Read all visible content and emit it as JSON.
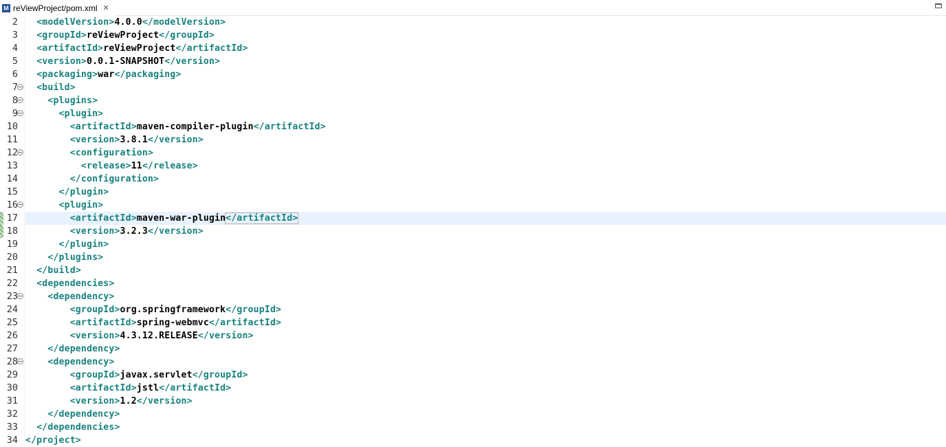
{
  "tab": {
    "icon_letter": "M",
    "title": "reViewProject/pom.xml",
    "close": "✕"
  },
  "colors": {
    "tag": "#17827f",
    "text": "#000000",
    "current_line": "#e8f2fe"
  },
  "editor": {
    "current_line": 17,
    "lines": [
      {
        "n": "2",
        "fold": false,
        "indent": "  ",
        "parts": [
          [
            "t",
            "<modelVersion>"
          ],
          [
            "x",
            "4.0.0"
          ],
          [
            "t",
            "</modelVersion>"
          ]
        ]
      },
      {
        "n": "3",
        "fold": false,
        "indent": "  ",
        "parts": [
          [
            "t",
            "<groupId>"
          ],
          [
            "x",
            "reViewProject"
          ],
          [
            "t",
            "</groupId>"
          ]
        ]
      },
      {
        "n": "4",
        "fold": false,
        "indent": "  ",
        "parts": [
          [
            "t",
            "<artifactId>"
          ],
          [
            "x",
            "reViewProject"
          ],
          [
            "t",
            "</artifactId>"
          ]
        ]
      },
      {
        "n": "5",
        "fold": false,
        "indent": "  ",
        "parts": [
          [
            "t",
            "<version>"
          ],
          [
            "x",
            "0.0.1-SNAPSHOT"
          ],
          [
            "t",
            "</version>"
          ]
        ]
      },
      {
        "n": "6",
        "fold": false,
        "indent": "  ",
        "parts": [
          [
            "t",
            "<packaging>"
          ],
          [
            "x",
            "war"
          ],
          [
            "t",
            "</packaging>"
          ]
        ]
      },
      {
        "n": "7",
        "fold": true,
        "indent": "  ",
        "parts": [
          [
            "t",
            "<build>"
          ]
        ]
      },
      {
        "n": "8",
        "fold": true,
        "indent": "    ",
        "parts": [
          [
            "t",
            "<plugins>"
          ]
        ]
      },
      {
        "n": "9",
        "fold": true,
        "indent": "      ",
        "parts": [
          [
            "t",
            "<plugin>"
          ]
        ]
      },
      {
        "n": "10",
        "fold": false,
        "indent": "        ",
        "parts": [
          [
            "t",
            "<artifactId>"
          ],
          [
            "x",
            "maven-compiler-plugin"
          ],
          [
            "t",
            "</artifactId>"
          ]
        ]
      },
      {
        "n": "11",
        "fold": false,
        "indent": "        ",
        "parts": [
          [
            "t",
            "<version>"
          ],
          [
            "x",
            "3.8.1"
          ],
          [
            "t",
            "</version>"
          ]
        ]
      },
      {
        "n": "12",
        "fold": true,
        "indent": "        ",
        "parts": [
          [
            "t",
            "<configuration>"
          ]
        ]
      },
      {
        "n": "13",
        "fold": false,
        "indent": "          ",
        "parts": [
          [
            "t",
            "<release>"
          ],
          [
            "x",
            "11"
          ],
          [
            "t",
            "</release>"
          ]
        ]
      },
      {
        "n": "14",
        "fold": false,
        "indent": "        ",
        "parts": [
          [
            "t",
            "</configuration>"
          ]
        ]
      },
      {
        "n": "15",
        "fold": false,
        "indent": "      ",
        "parts": [
          [
            "t",
            "</plugin>"
          ]
        ]
      },
      {
        "n": "16",
        "fold": true,
        "indent": "      ",
        "parts": [
          [
            "t",
            "<plugin>"
          ]
        ]
      },
      {
        "n": "17",
        "fold": false,
        "indent": "        ",
        "parts": [
          [
            "t",
            "<artifactId>"
          ],
          [
            "x",
            "maven-war-plugin"
          ],
          [
            "t",
            "</artifactId>"
          ]
        ]
      },
      {
        "n": "18",
        "fold": false,
        "indent": "        ",
        "parts": [
          [
            "t",
            "<version>"
          ],
          [
            "x",
            "3.2.3"
          ],
          [
            "t",
            "</version>"
          ]
        ]
      },
      {
        "n": "19",
        "fold": false,
        "indent": "      ",
        "parts": [
          [
            "t",
            "</plugin>"
          ]
        ]
      },
      {
        "n": "20",
        "fold": false,
        "indent": "    ",
        "parts": [
          [
            "t",
            "</plugins>"
          ]
        ]
      },
      {
        "n": "21",
        "fold": false,
        "indent": "  ",
        "parts": [
          [
            "t",
            "</build>"
          ]
        ]
      },
      {
        "n": "22",
        "fold": false,
        "indent": "  ",
        "parts": [
          [
            "t",
            "<dependencies>"
          ]
        ]
      },
      {
        "n": "23",
        "fold": true,
        "indent": "    ",
        "parts": [
          [
            "t",
            "<dependency>"
          ]
        ]
      },
      {
        "n": "24",
        "fold": false,
        "indent": "        ",
        "parts": [
          [
            "t",
            "<groupId>"
          ],
          [
            "x",
            "org.springframework"
          ],
          [
            "t",
            "</groupId>"
          ]
        ]
      },
      {
        "n": "25",
        "fold": false,
        "indent": "        ",
        "parts": [
          [
            "t",
            "<artifactId>"
          ],
          [
            "x",
            "spring-webmvc"
          ],
          [
            "t",
            "</artifactId>"
          ]
        ]
      },
      {
        "n": "26",
        "fold": false,
        "indent": "        ",
        "parts": [
          [
            "t",
            "<version>"
          ],
          [
            "x",
            "4.3.12.RELEASE"
          ],
          [
            "t",
            "</version>"
          ]
        ]
      },
      {
        "n": "27",
        "fold": false,
        "indent": "    ",
        "parts": [
          [
            "t",
            "</dependency>"
          ]
        ]
      },
      {
        "n": "28",
        "fold": true,
        "indent": "    ",
        "parts": [
          [
            "t",
            "<dependency>"
          ]
        ]
      },
      {
        "n": "29",
        "fold": false,
        "indent": "        ",
        "parts": [
          [
            "t",
            "<groupId>"
          ],
          [
            "x",
            "javax.servlet"
          ],
          [
            "t",
            "</groupId>"
          ]
        ]
      },
      {
        "n": "30",
        "fold": false,
        "indent": "        ",
        "parts": [
          [
            "t",
            "<artifactId>"
          ],
          [
            "x",
            "jstl"
          ],
          [
            "t",
            "</artifactId>"
          ]
        ]
      },
      {
        "n": "31",
        "fold": false,
        "indent": "        ",
        "parts": [
          [
            "t",
            "<version>"
          ],
          [
            "x",
            "1.2"
          ],
          [
            "t",
            "</version>"
          ]
        ]
      },
      {
        "n": "32",
        "fold": false,
        "indent": "    ",
        "parts": [
          [
            "t",
            "</dependency>"
          ]
        ]
      },
      {
        "n": "33",
        "fold": false,
        "indent": "  ",
        "parts": [
          [
            "t",
            "</dependencies>"
          ]
        ]
      },
      {
        "n": "34",
        "fold": false,
        "indent": "",
        "parts": [
          [
            "t",
            "</project>"
          ]
        ]
      }
    ]
  }
}
